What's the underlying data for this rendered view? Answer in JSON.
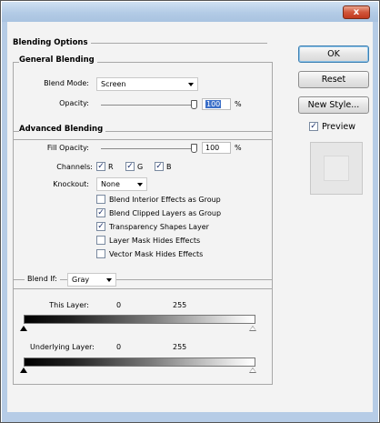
{
  "window": {
    "close_label": "x"
  },
  "blending_options": {
    "title": "Blending Options"
  },
  "general": {
    "title": "General Blending",
    "blend_mode_label": "Blend Mode:",
    "blend_mode_value": "Screen",
    "opacity_label": "Opacity:",
    "opacity_value": "100",
    "opacity_unit": "%",
    "opacity_level": 1.0
  },
  "advanced": {
    "title": "Advanced Blending",
    "fill_opacity_label": "Fill Opacity:",
    "fill_opacity_value": "100",
    "fill_opacity_unit": "%",
    "fill_opacity_level": 1.0,
    "channels_label": "Channels:",
    "channels": [
      {
        "label": "R",
        "checked": true
      },
      {
        "label": "G",
        "checked": true
      },
      {
        "label": "B",
        "checked": true
      }
    ],
    "knockout_label": "Knockout:",
    "knockout_value": "None",
    "options": [
      {
        "label": "Blend Interior Effects as Group",
        "checked": false
      },
      {
        "label": "Blend Clipped Layers as Group",
        "checked": true
      },
      {
        "label": "Transparency Shapes Layer",
        "checked": true
      },
      {
        "label": "Layer Mask Hides Effects",
        "checked": false
      },
      {
        "label": "Vector Mask Hides Effects",
        "checked": false
      }
    ]
  },
  "blend_if": {
    "label": "Blend If:",
    "value": "Gray",
    "this_layer": {
      "label": "This Layer:",
      "low": "0",
      "high": "255"
    },
    "underlying_layer": {
      "label": "Underlying Layer:",
      "low": "0",
      "high": "255"
    }
  },
  "buttons": {
    "ok": "OK",
    "reset": "Reset",
    "new_style": "New Style...",
    "preview_label": "Preview",
    "preview_checked": true
  },
  "icons": {
    "close": "close-icon",
    "dropdown": "chevron-down-icon",
    "check": "checkmark-icon"
  }
}
